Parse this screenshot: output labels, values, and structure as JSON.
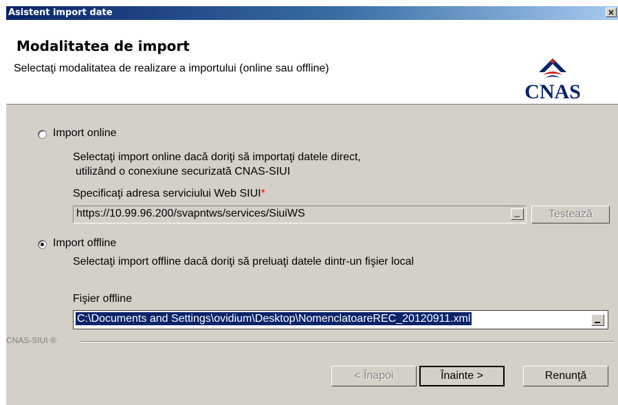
{
  "window": {
    "title": "Asistent import date",
    "close_label": "×"
  },
  "header": {
    "title": "Modalitatea de import",
    "subtitle": "Selectaţi modalitatea de realizare a importului (online sau offline)",
    "logo_text": "CNAS"
  },
  "online": {
    "label": "Import online",
    "selected": false,
    "desc_line1": "Selectaţi import online dacă doriţi să importaţi datele direct,",
    "desc_line2": "utilizând o conexiune securizată CNAS-SIUI",
    "url_label": "Specificaţi adresa serviciului Web SIUI",
    "required_mark": "*",
    "url_value": "https://10.99.96.200/svapntws/services/SiuiWS",
    "test_button": "Testează"
  },
  "offline": {
    "label": "Import offline",
    "selected": true,
    "desc": "Selectaţi import offline dacă doriţi să preluaţi datele dintr-un fişier local",
    "file_label": "Fişier offline",
    "file_value": "C:\\Documents and Settings\\ovidium\\Desktop\\NomenclatoareREC_20120911.xml"
  },
  "footer": {
    "brand": "CNAS-SIUI ®",
    "back_button": "< Înapoi",
    "next_button": "Înainte >",
    "cancel_button": "Renunţă"
  },
  "colors": {
    "titlebar": "#0a246a",
    "dialog_bg": "#d4d0c8",
    "selection": "#0a246a",
    "logo": "#0a246a",
    "required": "#ff0000"
  }
}
